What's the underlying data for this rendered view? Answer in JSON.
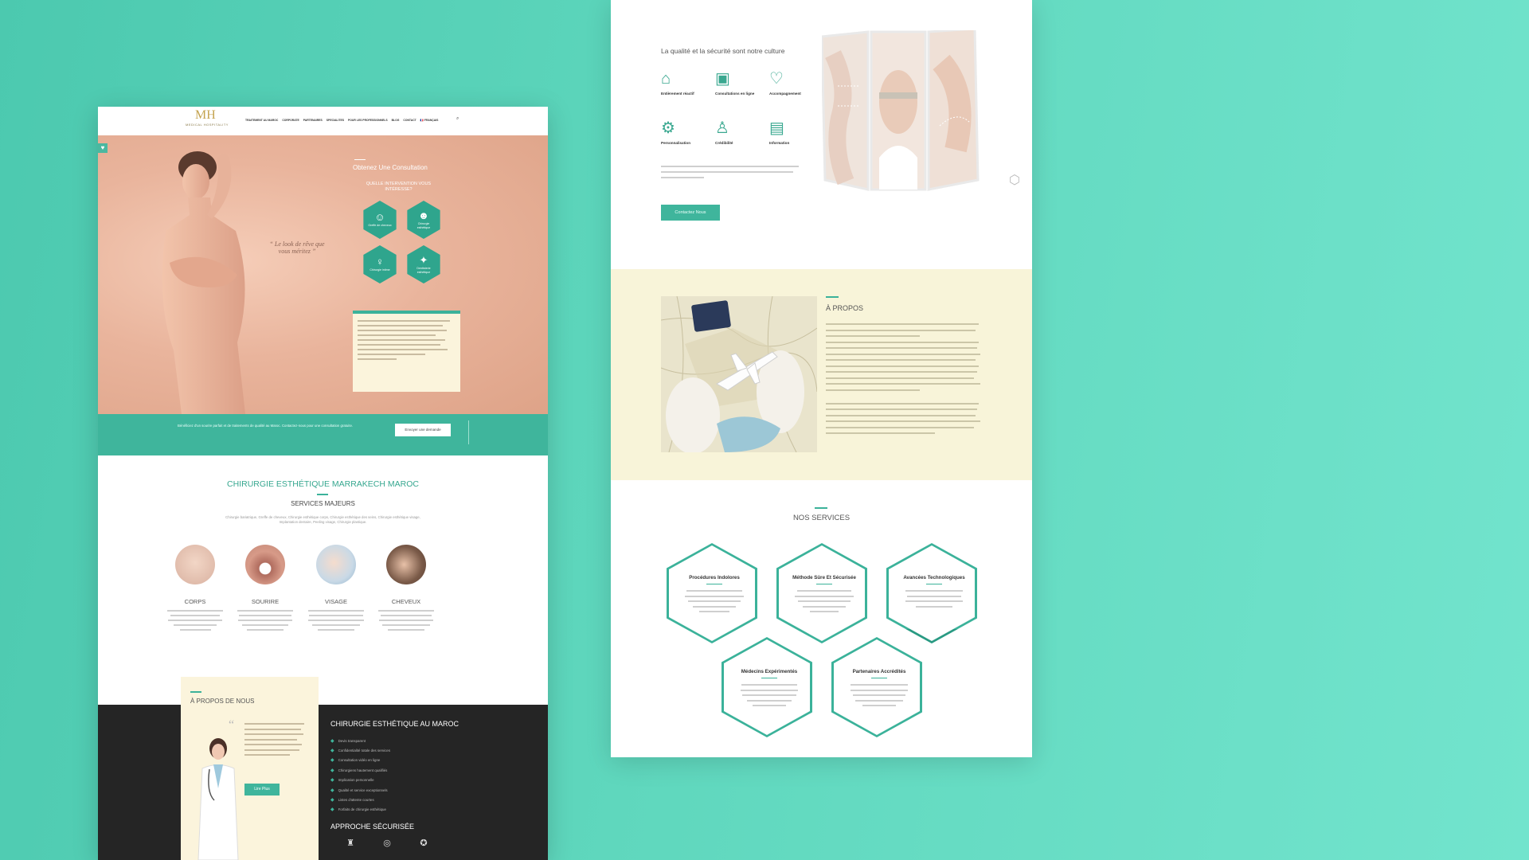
{
  "left_site": {
    "nav": {
      "logo_mark": "MH",
      "logo_text": "MEDICAL HOSPITALITY",
      "menu": [
        "TRAITEMENT AU MAROC",
        "CORPORATE",
        "PARTENAIRES",
        "SPECIALITES",
        "POUR LES PROFESSIONNELS",
        "BLOG",
        "CONTACT",
        "🇫🇷 FRANÇAIS"
      ]
    },
    "hero": {
      "quote": "“ Le look de rêve que vous méritez ”",
      "consult_title": "Obtenez Une Consultation",
      "consult_question": "QUELLE INTERVENTION VOUS INTÉRESSE?",
      "options": [
        {
          "label": "Greffe de cheveux",
          "icon": "hair-graft-icon"
        },
        {
          "label": "Chirurgie esthétique",
          "icon": "face-surgery-icon"
        },
        {
          "label": "Chirurgie intime",
          "icon": "intimate-surgery-icon"
        },
        {
          "label": "Dentisterie esthétique",
          "icon": "tooth-icon"
        }
      ]
    },
    "band": {
      "text": "Bénéficiez d'un sourire parfait et de traitements de qualité au Maroc. Contactez-nous pour une consultation gratuite.",
      "button": "Envoyer une demande"
    },
    "services": {
      "title": "CHIRURGIE ESTHÉTIQUE MARRAKECH MAROC",
      "subtitle": "SERVICES MAJEURS",
      "description": "Chirurgie bariatrique, Greffe de cheveux, Chirurgie esthétique corps, Chirurgie esthétique des seins, Chirurgie esthétique visage, Implantation dentaire, Peeling visage, Chirurgie plastique.",
      "items": [
        {
          "name": "CORPS"
        },
        {
          "name": "SOURIRE"
        },
        {
          "name": "VISAGE"
        },
        {
          "name": "CHEVEUX"
        }
      ]
    },
    "about": {
      "title": "À PROPOS DE NOUS",
      "button": "Lire Plus"
    },
    "dark": {
      "title": "CHIRURGIE ESTHÉTIQUE AU MAROC",
      "list": [
        "Devis transparent",
        "Confidentialité totale des services",
        "Consultation vidéo en ligne",
        "Chirurgiens hautement qualifiés",
        "Implication personnelle",
        "Qualité et service exceptionnels",
        "Listes d'attente courtes",
        "Forfaits de chirurgie esthétique"
      ],
      "title2": "APPROCHE SÉCURISÉE"
    }
  },
  "right_site": {
    "quality": {
      "title": "La qualité et la sécurité sont notre culture",
      "features": [
        {
          "label": "Entièrement réactif",
          "icon": "responsive-icon"
        },
        {
          "label": "Consultations en ligne",
          "icon": "online-consult-icon"
        },
        {
          "label": "Accompagnement",
          "icon": "support-icon"
        },
        {
          "label": "Personnalisation",
          "icon": "personalization-icon"
        },
        {
          "label": "Crédibilité",
          "icon": "credibility-icon"
        },
        {
          "label": "Information",
          "icon": "information-icon"
        }
      ],
      "button": "Contactez Nous"
    },
    "apropos": {
      "title": "À PROPOS"
    },
    "nos_services": {
      "title": "NOS SERVICES",
      "items": [
        {
          "title": "Procédures Indolores"
        },
        {
          "title": "Méthode Sûre Et Sécurisée"
        },
        {
          "title": "Avancées Technologiques"
        },
        {
          "title": "Médecins Expérimentés"
        },
        {
          "title": "Partenaires Accrédités"
        }
      ]
    }
  },
  "colors": {
    "background": "#5fd7bd",
    "accent_teal": "#3bb29a",
    "cream": "#f8f4d9",
    "dark": "#252525",
    "hero_peach": "#e9b49c"
  }
}
